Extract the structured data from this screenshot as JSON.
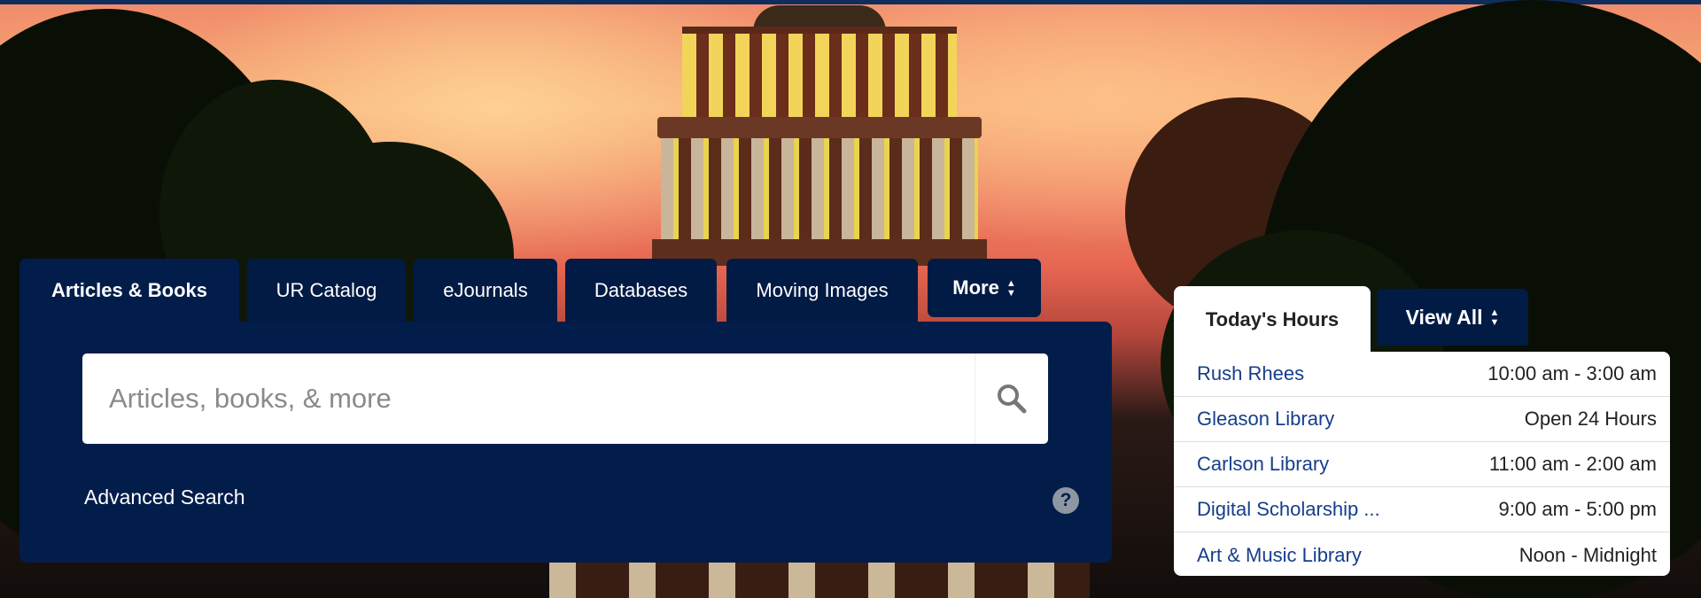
{
  "search": {
    "tabs": [
      {
        "label": "Articles & Books",
        "active": true
      },
      {
        "label": "UR Catalog"
      },
      {
        "label": "eJournals"
      },
      {
        "label": "Databases"
      },
      {
        "label": "Moving Images"
      }
    ],
    "more_label": "More",
    "placeholder": "Articles, books, & more",
    "advanced_label": "Advanced Search",
    "help_symbol": "?"
  },
  "hours": {
    "tab_label": "Today's Hours",
    "view_all_label": "View All",
    "rows": [
      {
        "name": "Rush Rhees",
        "time": "10:00 am - 3:00 am"
      },
      {
        "name": "Gleason Library",
        "time": "Open 24 Hours"
      },
      {
        "name": "Carlson Library",
        "time": "11:00 am - 2:00 am"
      },
      {
        "name": "Digital Scholarship ...",
        "time": "9:00 am - 5:00 pm"
      },
      {
        "name": "Art & Music Library",
        "time": "Noon - Midnight"
      }
    ]
  },
  "icons": {
    "search": "magnifier-icon",
    "updown": "sort-updown-icon",
    "help": "help-circle-icon"
  },
  "colors": {
    "panel": "#031d4a",
    "tab": "#021b45",
    "link": "#163e8a",
    "topbar": "#0f2e5e"
  }
}
